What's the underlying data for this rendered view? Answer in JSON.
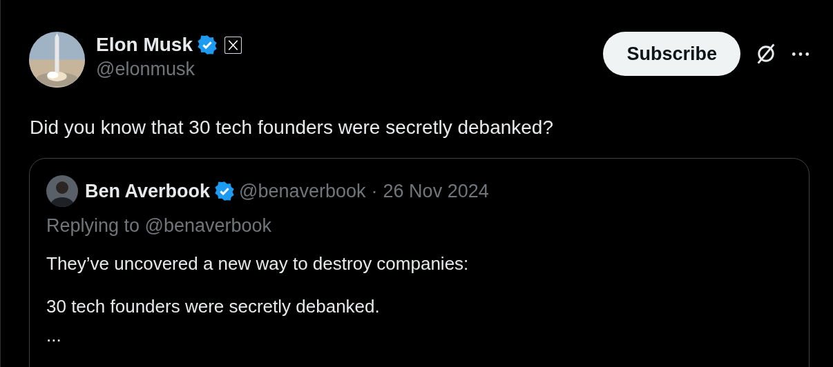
{
  "author": {
    "name": "Elon Musk",
    "verified": true,
    "affiliate": true,
    "handle": "@elonmusk"
  },
  "subscribe_button": "Subscribe",
  "text": "Did you know that 30 tech founders were secretly debanked?",
  "quote": {
    "name": "Ben Averbook",
    "verified": true,
    "handle": "@benaverbook",
    "separator": "·",
    "date": "26 Nov 2024",
    "replying_to": "Replying to @benaverbook",
    "paragraphs": [
      [
        "They’ve uncovered a new way to destroy companies:"
      ],
      [
        "30 tech founders were secretly debanked.",
        "..."
      ]
    ]
  }
}
